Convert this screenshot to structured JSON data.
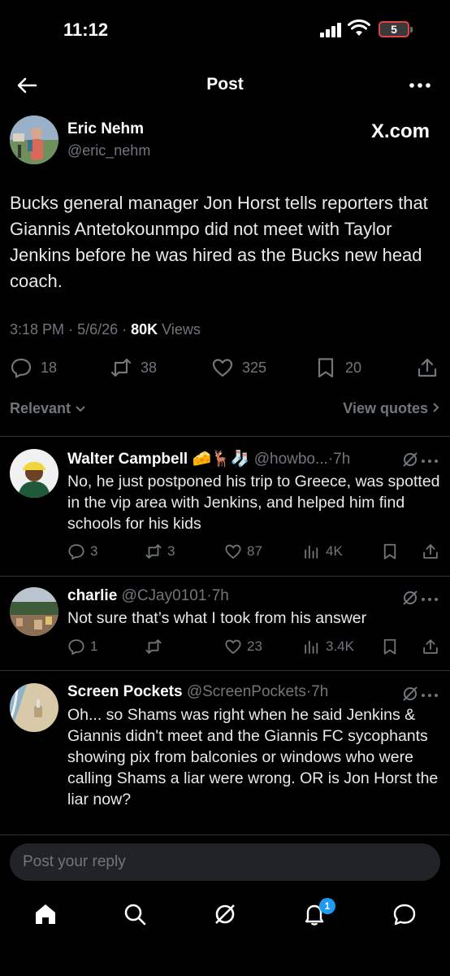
{
  "status_bar": {
    "time": "11:12",
    "battery": "5"
  },
  "nav": {
    "title": "Post"
  },
  "post": {
    "author_name": "Eric Nehm",
    "author_handle": "@eric_nehm",
    "source_label": "X.com",
    "text": "Bucks general manager Jon Horst tells reporters that Giannis Antetokounmpo did not meet with Taylor Jenkins before he was hired as the Bucks new head coach.",
    "time": "3:18 PM",
    "date": "5/6/26",
    "views_count": "80K",
    "views_label": "Views",
    "replies": "18",
    "reposts": "38",
    "likes": "325",
    "bookmarks": "20"
  },
  "filter": {
    "sort_label": "Relevant",
    "view_quotes_label": "View quotes"
  },
  "replies": [
    {
      "name": "Walter Campbell",
      "emojis": "🧀🦌🧦",
      "handle": "@howbo...",
      "age": "7h",
      "text": "No, he just postponed his trip to Greece, was spotted in the vip area with Jenkins, and helped him find schools for his kids",
      "replies": "3",
      "reposts": "3",
      "likes": "87",
      "views": "4K"
    },
    {
      "name": "charlie",
      "handle": "@CJay0101",
      "age": "7h",
      "text": "Not sure that’s what I took from his answer",
      "replies": "1",
      "reposts": "",
      "likes": "23",
      "views": "3.4K"
    },
    {
      "name": "Screen Pockets",
      "handle": "@ScreenPockets",
      "age": "7h",
      "text": "Oh... so Shams was right when he said Jenkins & Giannis didn't meet and the Giannis FC sycophants showing pix from balconies or windows who were calling Shams a liar were wrong. OR is Jon Horst the liar now?"
    }
  ],
  "reply_box": {
    "placeholder": "Post your reply"
  },
  "tab_bar": {
    "notification_count": "1"
  },
  "colors": {
    "background": "#000000",
    "text": "#e7e9ea",
    "muted": "#71767b",
    "accent": "#1d9bf0",
    "divider": "#2f3336"
  },
  "icons": [
    "back-arrow-icon",
    "more-icon",
    "reply-icon",
    "repost-icon",
    "like-icon",
    "bookmark-icon",
    "share-icon",
    "views-icon",
    "grok-icon",
    "home-icon",
    "search-icon",
    "notifications-icon",
    "messages-icon"
  ]
}
